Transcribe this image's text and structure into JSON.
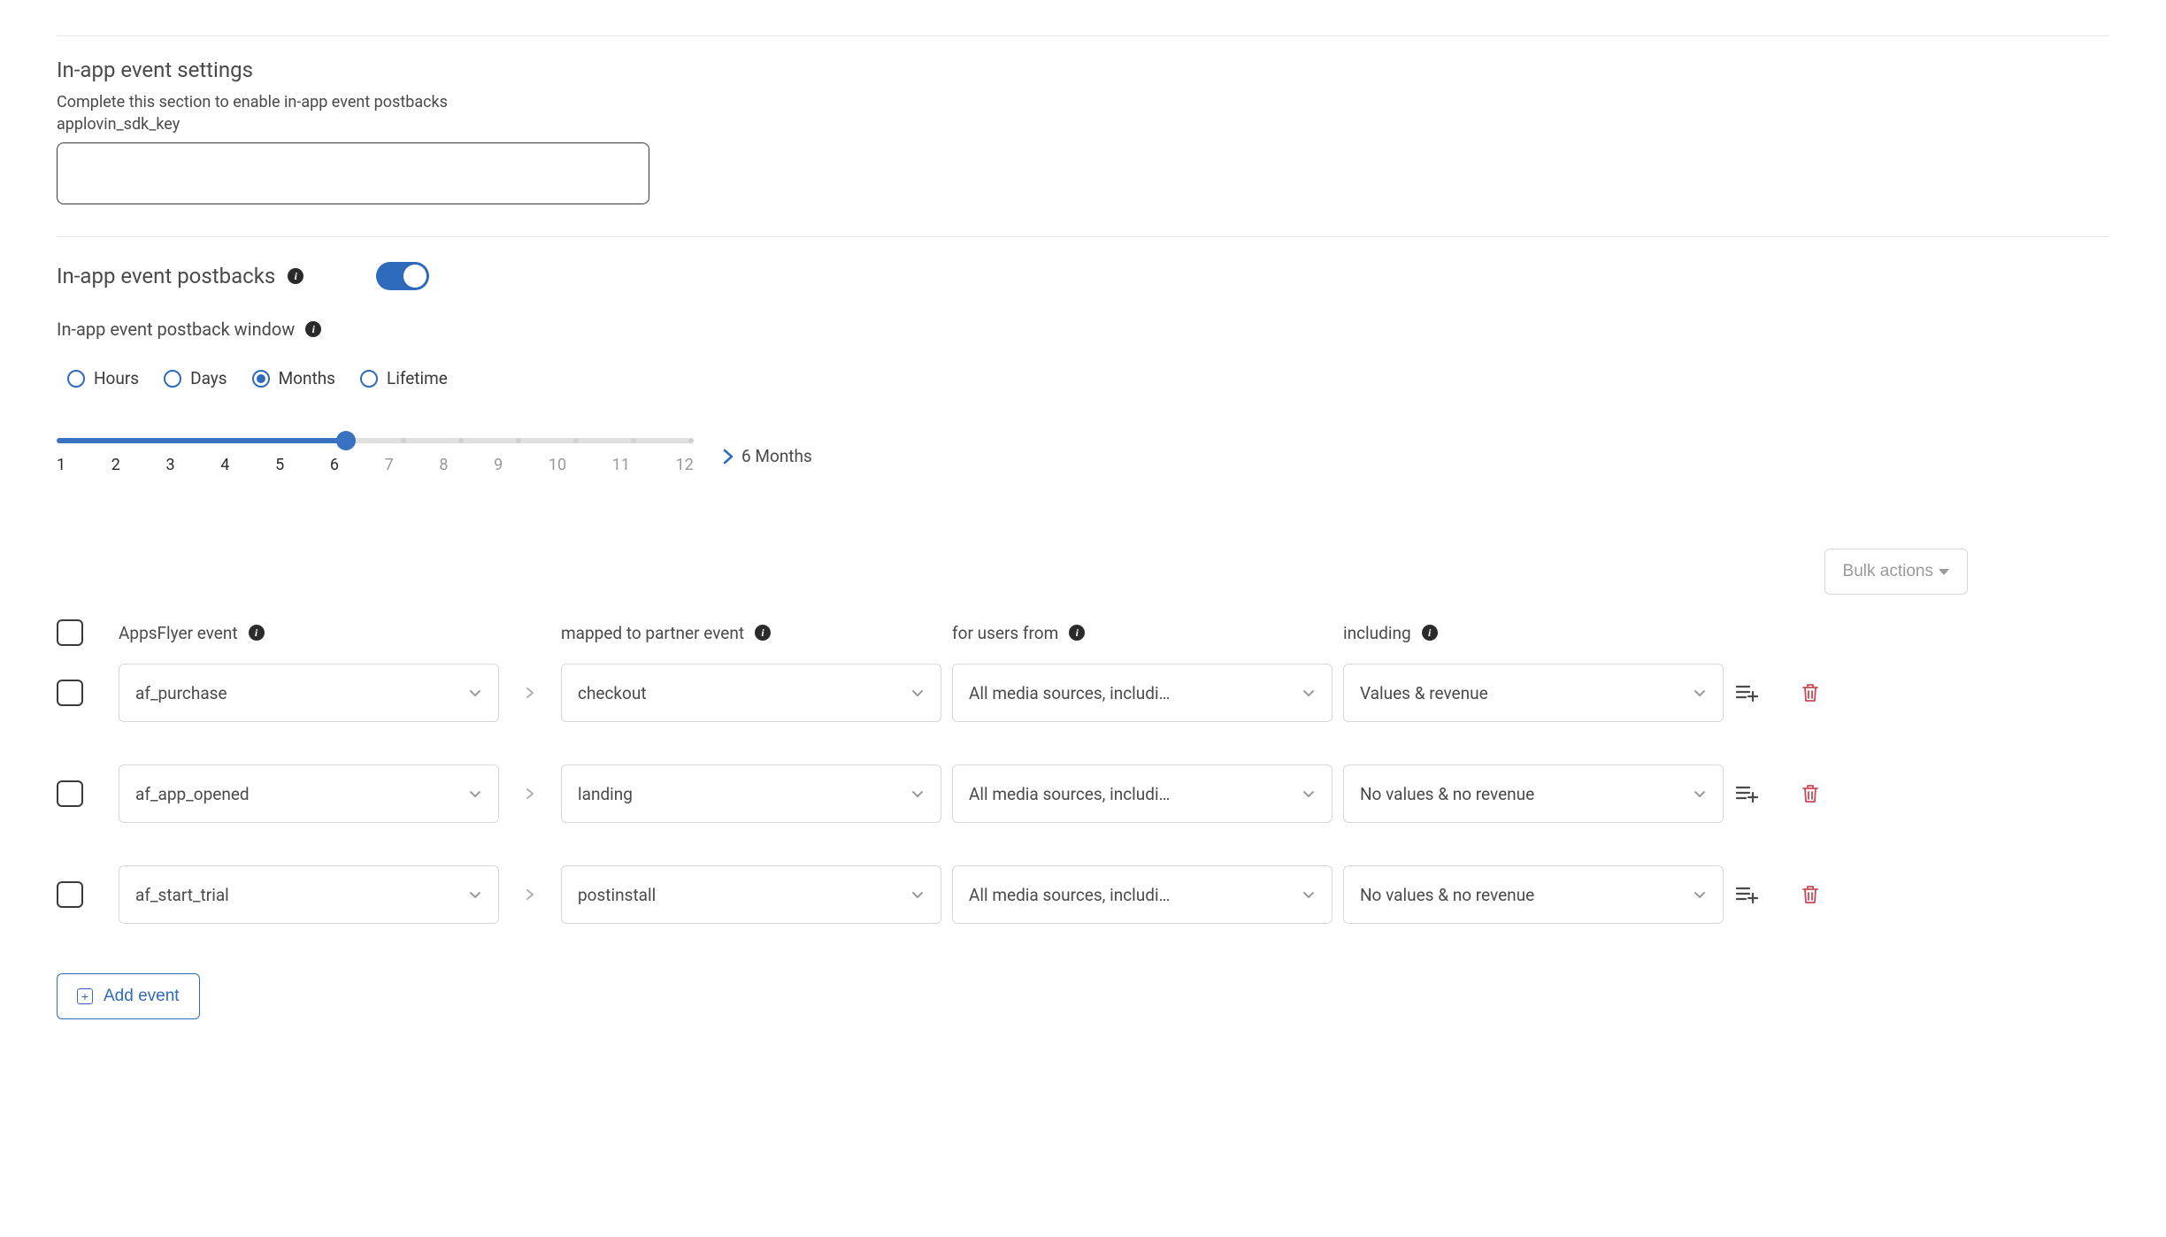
{
  "settings": {
    "title": "In-app event settings",
    "subtitle": "Complete this section to enable in-app event postbacks",
    "sdk_key_label": "applovin_sdk_key",
    "sdk_key_value": ""
  },
  "postbacks": {
    "title": "In-app event postbacks",
    "enabled": true,
    "window_label": "In-app event postback window",
    "unit_options": [
      "Hours",
      "Days",
      "Months",
      "Lifetime"
    ],
    "selected_unit_index": 2,
    "slider": {
      "min": 1,
      "max": 12,
      "value": 6,
      "ticks": [
        "1",
        "2",
        "3",
        "4",
        "5",
        "6",
        "7",
        "8",
        "9",
        "10",
        "11",
        "12"
      ],
      "readout": "6 Months"
    }
  },
  "bulk_actions_label": "Bulk actions",
  "table": {
    "headers": {
      "col1": "AppsFlyer event",
      "col2": "mapped to partner event",
      "col3": "for users from",
      "col4": "including"
    },
    "rows": [
      {
        "af_event": "af_purchase",
        "partner_event": "checkout",
        "users_from": "All media sources, includi…",
        "including": "Values & revenue"
      },
      {
        "af_event": "af_app_opened",
        "partner_event": "landing",
        "users_from": "All media sources, includi…",
        "including": "No values & no revenue"
      },
      {
        "af_event": "af_start_trial",
        "partner_event": "postinstall",
        "users_from": "All media sources, includi…",
        "including": "No values & no revenue"
      }
    ]
  },
  "add_event_label": "Add event"
}
